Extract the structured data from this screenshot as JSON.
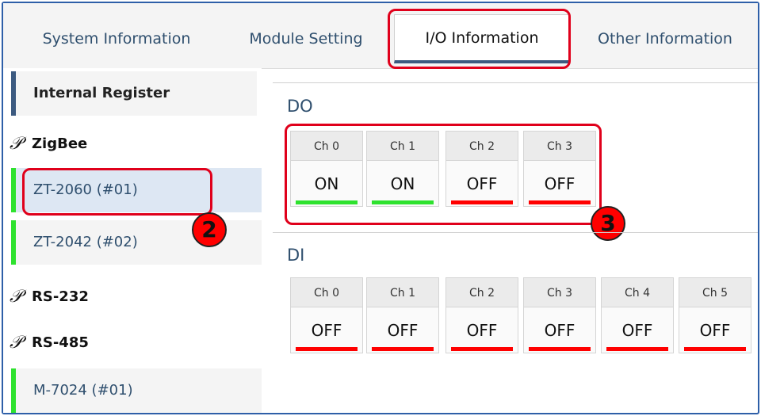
{
  "tabs": [
    {
      "label": "System Information",
      "active": false
    },
    {
      "label": "Module Setting",
      "active": false
    },
    {
      "label": "I/O Information",
      "active": true
    },
    {
      "label": "Other Information",
      "active": false
    }
  ],
  "sidebar": {
    "internal_register": "Internal Register",
    "groups": {
      "zigbee": {
        "label": "ZigBee",
        "modules": [
          "ZT-2060 (#01)",
          "ZT-2042 (#02)"
        ]
      },
      "rs232": {
        "label": "RS-232"
      },
      "rs485": {
        "label": "RS-485",
        "modules": [
          "M-7024 (#01)"
        ]
      }
    },
    "link_icon_glyph": "𝒫"
  },
  "annotations": {
    "badge_2": "2",
    "badge_3": "3"
  },
  "colors": {
    "on": "#2ee22e",
    "off": "#ff0000",
    "highlight": "#e0001b",
    "accent": "#3c5a80"
  },
  "do": {
    "title": "DO",
    "channels": [
      {
        "name": "Ch 0",
        "state": "ON"
      },
      {
        "name": "Ch 1",
        "state": "ON"
      },
      {
        "name": "Ch 2",
        "state": "OFF"
      },
      {
        "name": "Ch 3",
        "state": "OFF"
      }
    ]
  },
  "di": {
    "title": "DI",
    "channels": [
      {
        "name": "Ch 0",
        "state": "OFF"
      },
      {
        "name": "Ch 1",
        "state": "OFF"
      },
      {
        "name": "Ch 2",
        "state": "OFF"
      },
      {
        "name": "Ch 3",
        "state": "OFF"
      },
      {
        "name": "Ch 4",
        "state": "OFF"
      },
      {
        "name": "Ch 5",
        "state": "OFF"
      }
    ]
  }
}
